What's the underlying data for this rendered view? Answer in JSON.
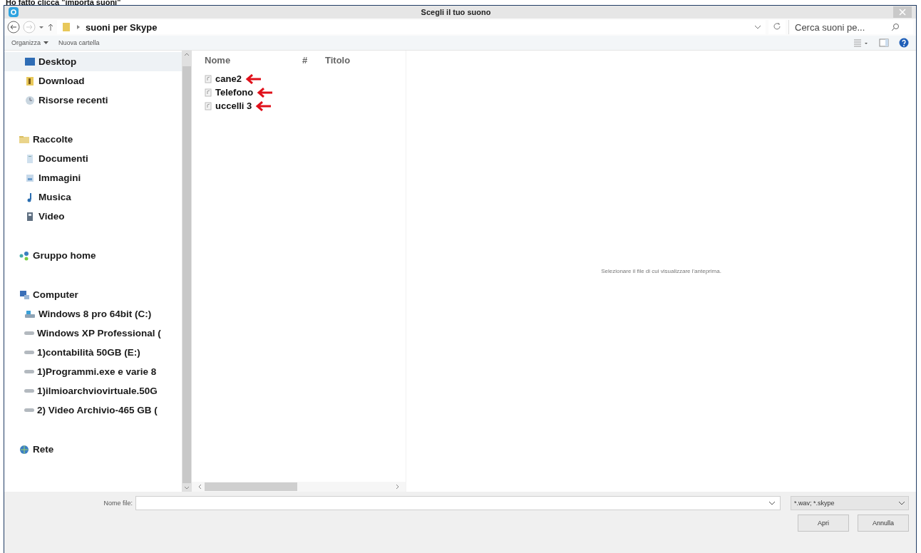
{
  "caption": "Ho fatto clicca \"importa suoni\"",
  "window": {
    "title": "Scegli il tuo suono"
  },
  "address_bar": {
    "path": [
      "suoni per Skype"
    ],
    "search_placeholder": "Cerca suoni pe..."
  },
  "toolbar": {
    "buttons": [
      {
        "label": "Organizza",
        "has_menu": true
      },
      {
        "label": "Nuova cartella",
        "has_menu": false
      }
    ]
  },
  "sidebar": {
    "sections": [
      {
        "items": [
          {
            "label": "Desktop",
            "selected": true
          },
          {
            "label": "Download",
            "selected": false
          },
          {
            "label": "Risorse recenti",
            "selected": false
          }
        ]
      },
      {
        "label": "Raccolte",
        "items": [
          {
            "label": "Documenti",
            "selected": false
          },
          {
            "label": "Immagini",
            "selected": false
          },
          {
            "label": "Musica",
            "selected": false
          },
          {
            "label": "Video",
            "selected": false
          }
        ]
      },
      {
        "label": "Gruppo home"
      },
      {
        "label": "Computer",
        "items": [
          {
            "label": "Windows 8 pro 64bit (C:)",
            "selected": false
          },
          {
            "label": "Windows XP Professional (",
            "selected": false
          },
          {
            "label": "1)contabilità 50GB (E:)",
            "selected": false
          },
          {
            "label": "1)Programmi.exe e varie 8",
            "selected": false
          },
          {
            "label": "1)ilmioarchviovirtuale.50G",
            "selected": false
          },
          {
            "label": "2) Video Archivio-465 GB (",
            "selected": false
          }
        ]
      },
      {
        "label": "Rete"
      }
    ]
  },
  "file_list": {
    "columns": [
      "Nome",
      "#",
      "Titolo"
    ],
    "rows": [
      {
        "name": "cane2",
        "marked": true
      },
      {
        "name": "Telefono",
        "marked": true
      },
      {
        "name": "uccelli 3",
        "marked": true
      }
    ]
  },
  "preview": {
    "message": "Selezionare il file di cui visualizzare l'anteprima."
  },
  "footer": {
    "filename_label": "Nome file:",
    "filter": "*.wav; *.skype",
    "buttons": [
      "Apri",
      "Annulla"
    ]
  }
}
